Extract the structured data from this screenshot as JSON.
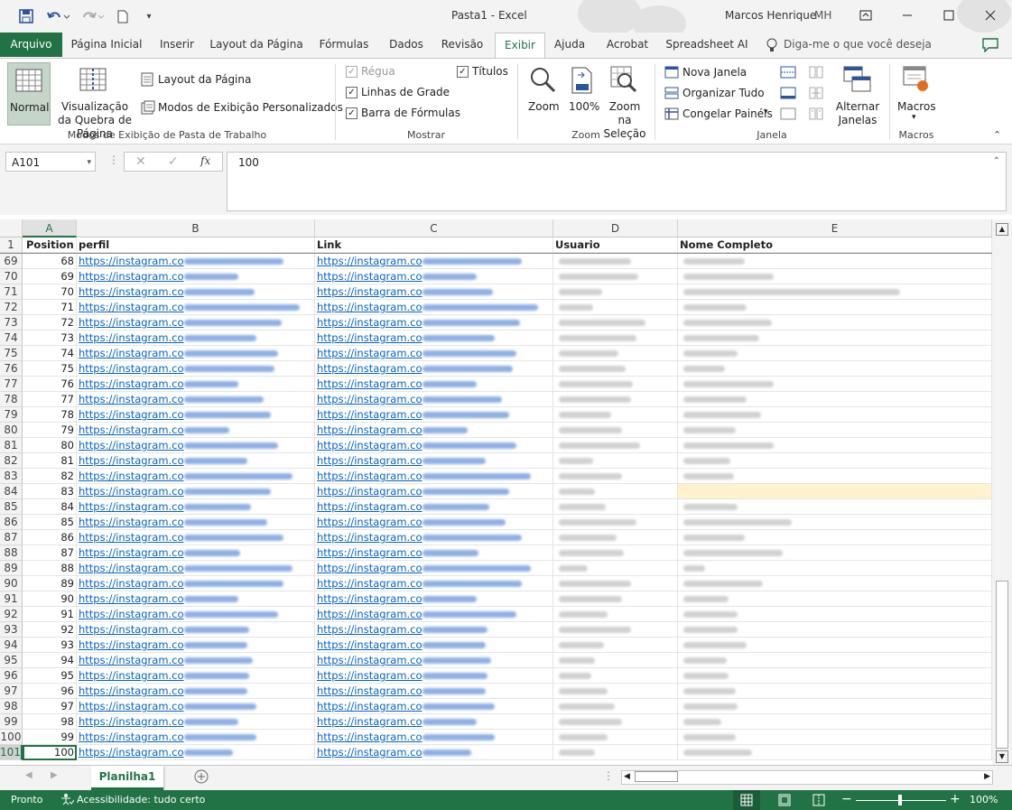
{
  "window": {
    "title": "Pasta1  -  Excel",
    "user": "Marcos Henrique",
    "initials": "MH"
  },
  "tabs": [
    "Arquivo",
    "Página Inicial",
    "Inserir",
    "Layout da Página",
    "Fórmulas",
    "Dados",
    "Revisão",
    "Exibir",
    "Ajuda",
    "Acrobat",
    "Spreadsheet AI"
  ],
  "tell_me": "Diga-me o que você deseja fazer",
  "ribbon": {
    "group1": {
      "normal": "Normal",
      "quebra": "Visualização da Quebra de Página",
      "layout": "Layout da Página",
      "modos": "Modos de Exibição Personalizados",
      "label": "Modos de Exibição de Pasta de Trabalho"
    },
    "group2": {
      "regua": "Régua",
      "titulos": "Títulos",
      "linhas": "Linhas de Grade",
      "barra": "Barra de Fórmulas",
      "label": "Mostrar"
    },
    "group3": {
      "zoom": "Zoom",
      "cem": "100%",
      "zoomsel": "Zoom na Seleção",
      "label": "Zoom"
    },
    "group4": {
      "nova": "Nova Janela",
      "organizar": "Organizar Tudo",
      "congelar": "Congelar Painéis",
      "alternar": "Alternar Janelas",
      "label": "Janela"
    },
    "group5": {
      "macros": "Macros",
      "label": "Macros"
    }
  },
  "formula": {
    "namebox": "A101",
    "fx": "fx",
    "value": "100"
  },
  "columns": [
    "A",
    "B",
    "C",
    "D",
    "E"
  ],
  "header_row": {
    "num": "1",
    "a": "Position",
    "b": "perfil",
    "c": "Link",
    "d": "Usuario",
    "e": "Nome Completo"
  },
  "link_prefix": "https://instagram.co",
  "rows": [
    {
      "n": "69",
      "pos": "68"
    },
    {
      "n": "70",
      "pos": "69"
    },
    {
      "n": "71",
      "pos": "70"
    },
    {
      "n": "72",
      "pos": "71"
    },
    {
      "n": "73",
      "pos": "72"
    },
    {
      "n": "74",
      "pos": "73"
    },
    {
      "n": "75",
      "pos": "74"
    },
    {
      "n": "76",
      "pos": "75"
    },
    {
      "n": "77",
      "pos": "76"
    },
    {
      "n": "78",
      "pos": "77"
    },
    {
      "n": "79",
      "pos": "78"
    },
    {
      "n": "80",
      "pos": "79"
    },
    {
      "n": "81",
      "pos": "80"
    },
    {
      "n": "82",
      "pos": "81"
    },
    {
      "n": "83",
      "pos": "82"
    },
    {
      "n": "84",
      "pos": "83"
    },
    {
      "n": "85",
      "pos": "84"
    },
    {
      "n": "86",
      "pos": "85"
    },
    {
      "n": "87",
      "pos": "86"
    },
    {
      "n": "88",
      "pos": "87"
    },
    {
      "n": "89",
      "pos": "88"
    },
    {
      "n": "90",
      "pos": "89"
    },
    {
      "n": "91",
      "pos": "90"
    },
    {
      "n": "92",
      "pos": "91"
    },
    {
      "n": "93",
      "pos": "92"
    },
    {
      "n": "94",
      "pos": "93"
    },
    {
      "n": "95",
      "pos": "94"
    },
    {
      "n": "96",
      "pos": "95"
    },
    {
      "n": "97",
      "pos": "96"
    },
    {
      "n": "98",
      "pos": "97"
    },
    {
      "n": "99",
      "pos": "98"
    },
    {
      "n": "100",
      "pos": "99"
    },
    {
      "n": "101",
      "pos": "100"
    }
  ],
  "sheet": {
    "name": "Planilha1"
  },
  "status": {
    "ready": "Pronto",
    "access": "Acessibilidade: tudo certo",
    "zoom": "100%"
  },
  "colors": {
    "accent": "#217346",
    "link": "#0563c1",
    "highlight": "#fff2cc"
  }
}
